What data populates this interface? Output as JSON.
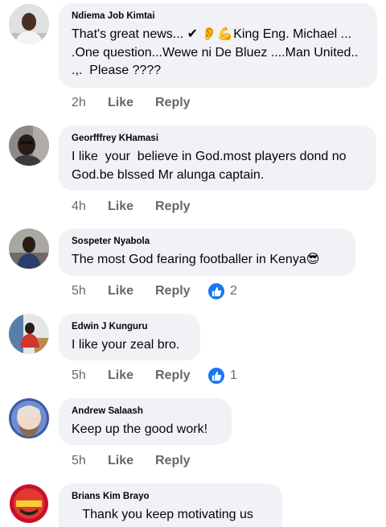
{
  "comments": [
    {
      "author": "Ndiema Job Kimtai",
      "text": "That's great news... ✔ 👂💪King Eng. Michael ...\n.One question...Wewe ni De Bluez ....Man United..\n.,.  Please ????",
      "time": "2h",
      "like_label": "Like",
      "reply_label": "Reply"
    },
    {
      "author": "Georfffrey KHamasi",
      "text": "I like  your  believe in God.most players dond no\nGod.be blssed Mr alunga captain.",
      "time": "4h",
      "like_label": "Like",
      "reply_label": "Reply"
    },
    {
      "author": "Sospeter Nyabola",
      "text": "The most God fearing footballer in Kenya😎",
      "time": "5h",
      "like_label": "Like",
      "reply_label": "Reply",
      "reaction_count": "2"
    },
    {
      "author": "Edwin J Kunguru",
      "text": "I like your zeal bro.",
      "time": "5h",
      "like_label": "Like",
      "reply_label": "Reply",
      "reaction_count": "1"
    },
    {
      "author": "Andrew Salaash",
      "text": "Keep up the good work!",
      "time": "5h",
      "like_label": "Like",
      "reply_label": "Reply"
    },
    {
      "author": "Brians Kim Brayo",
      "text": "   Thank you keep motivating us"
    }
  ],
  "colors": {
    "bubble": "#f0f2f5",
    "meta_text": "#65676b",
    "like_blue": "#1877f2"
  }
}
